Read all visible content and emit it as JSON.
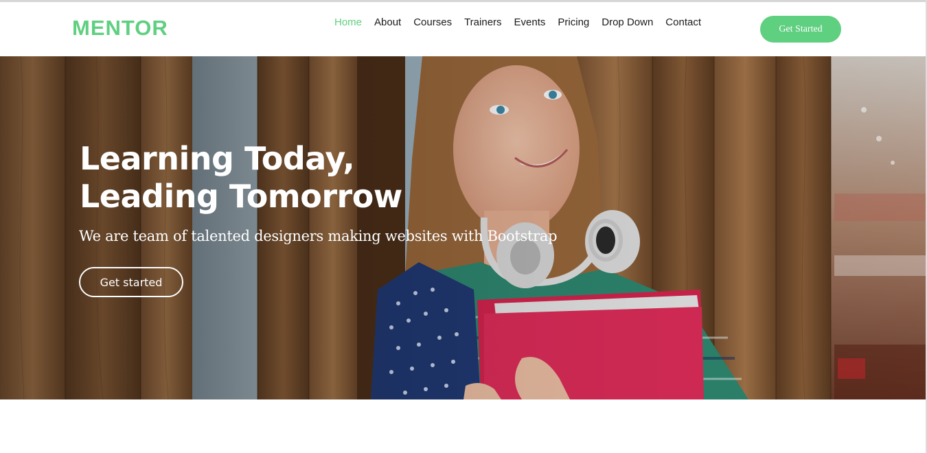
{
  "brand": {
    "name": "MENTOR",
    "color": "#5fcf80"
  },
  "nav": {
    "items": [
      {
        "label": "Home",
        "active": true
      },
      {
        "label": "About",
        "active": false
      },
      {
        "label": "Courses",
        "active": false
      },
      {
        "label": "Trainers",
        "active": false
      },
      {
        "label": "Events",
        "active": false
      },
      {
        "label": "Pricing",
        "active": false
      },
      {
        "label": "Drop Down",
        "active": false
      },
      {
        "label": "Contact",
        "active": false
      }
    ],
    "cta_label": "Get Started"
  },
  "hero": {
    "title_line1": "Learning Today,",
    "title_line2": "Leading Tomorrow",
    "subtitle": "We are team of talented designers making websites with Bootstrap",
    "button_label": "Get started",
    "image_icon": "student-photo-background"
  },
  "colors": {
    "accent": "#5fcf80",
    "text_dark": "#1a1a1a",
    "white": "#ffffff"
  }
}
